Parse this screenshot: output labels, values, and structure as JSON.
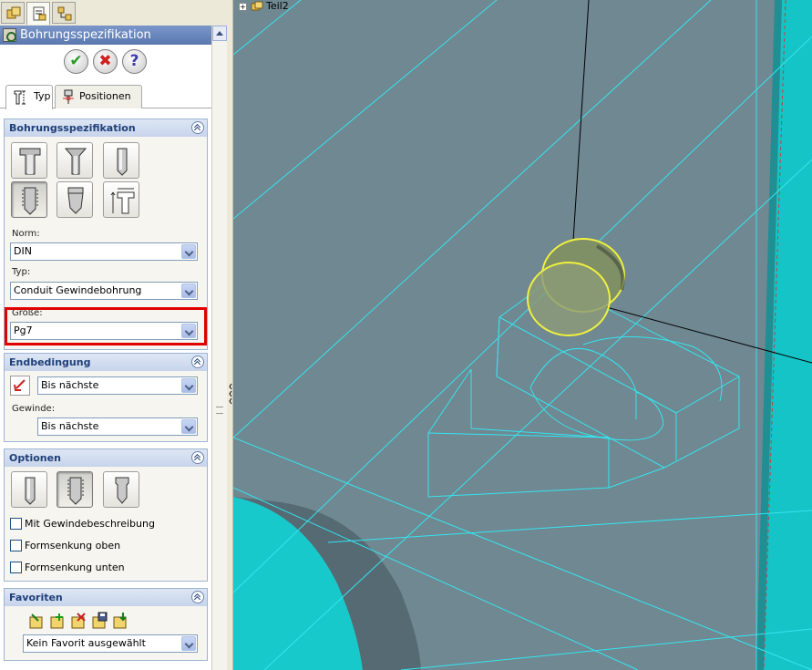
{
  "panel": {
    "top_tabs": [
      {
        "name": "feature-manager-icon"
      },
      {
        "name": "property-manager-icon"
      },
      {
        "name": "configuration-manager-icon"
      }
    ],
    "title": "Bohrungsspezifikation",
    "sub_tabs": {
      "type_label": "Typ",
      "positions_label": "Positionen"
    }
  },
  "hole_spec": {
    "header": "Bohrungsspezifikation",
    "hole_types": [
      "counterbore-icon",
      "countersink-icon",
      "simple-hole-icon",
      "tapped-hole-icon",
      "pipe-tap-icon",
      "legacy-hole-icon"
    ],
    "selected_type_index": 3,
    "norm_label": "Norm:",
    "norm_value": "DIN",
    "type_label": "Typ:",
    "type_value": "Conduit Gewindebohrung",
    "size_label": "Größe:",
    "size_value": "Pg7"
  },
  "end_condition": {
    "header": "Endbedingung",
    "value": "Bis nächste",
    "thread_label": "Gewinde:",
    "thread_value": "Bis nächste"
  },
  "options": {
    "header": "Optionen",
    "selected_index": 1,
    "checkboxes": [
      {
        "label": "Mit Gewindebeschreibung",
        "checked": false
      },
      {
        "label": "Formsenkung oben",
        "checked": false
      },
      {
        "label": "Formsenkung unten",
        "checked": false
      }
    ]
  },
  "favorites": {
    "header": "Favoriten",
    "selected": "Kein Favorit ausgewählt"
  },
  "tree": {
    "part_label": "Teil2"
  },
  "colors": {
    "viewport_bg": "#6f8891",
    "edge_cyan": "#35e5f0",
    "selection_yellow": "#f0f040",
    "highlight_red": "#e00000"
  }
}
